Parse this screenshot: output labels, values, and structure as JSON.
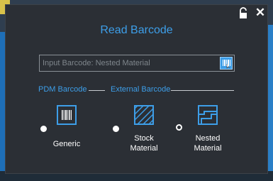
{
  "dialog": {
    "title": "Read Barcode",
    "lock_icon": "lock-open-icon",
    "close_label": "✕"
  },
  "input": {
    "placeholder": "Input Barcode: Nested Material",
    "value": "",
    "scan_icon": "barcode-scan-icon"
  },
  "sections": {
    "pdm": "PDM Barcode",
    "external": "External Barcode"
  },
  "options": [
    {
      "line1": "Generic",
      "line2": "",
      "icon": "barcode-icon",
      "selected": true
    },
    {
      "line1": "Stock",
      "line2": "Material",
      "icon": "hatched-square-icon",
      "selected": true
    },
    {
      "line1": "Nested",
      "line2": "Material",
      "icon": "nested-shape-icon",
      "selected": false
    }
  ],
  "colors": {
    "accent": "#3d9ee8",
    "dialog_bg": "#2b2f35",
    "text": "#ffffff"
  }
}
